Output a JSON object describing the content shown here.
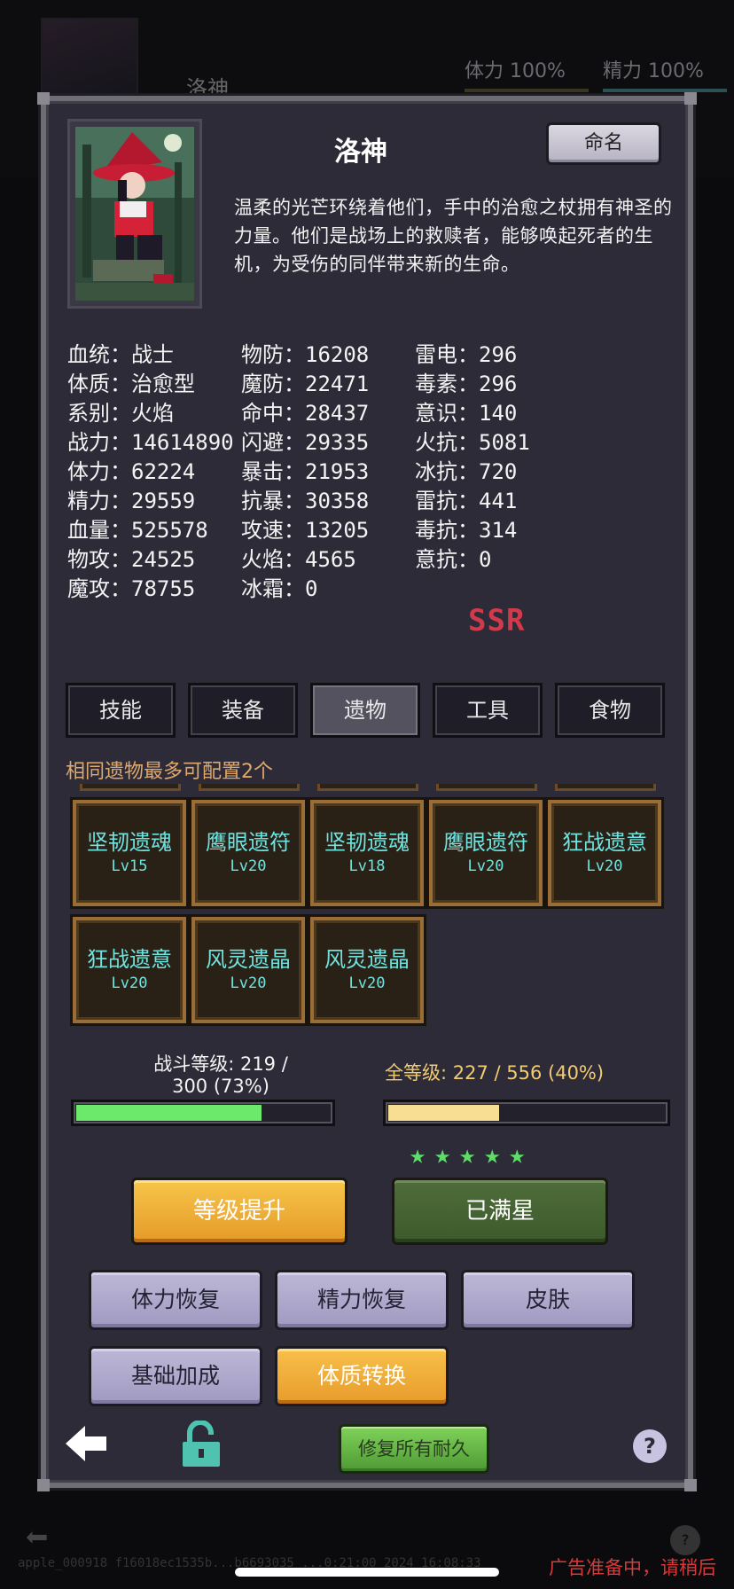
{
  "background": {
    "name": "洛神",
    "stamina_label": "体力 100%",
    "energy_label": "精力 100%",
    "ad_text": "广告准备中，请稍后",
    "footer_text": "apple_000918 f16018ec1535b...b6693035 ...0:21:00 2024 16:08:33"
  },
  "hero": {
    "name": "洛神",
    "rename_label": "命名",
    "description": "温柔的光芒环绕着他们，手中的治愈之杖拥有神圣的力量。他们是战场上的救赎者，能够唤起死者的生机，为受伤的同伴带来新的生命。"
  },
  "stats": {
    "col1": [
      {
        "key": "血统：",
        "value": "战士"
      },
      {
        "key": "体质：",
        "value": "治愈型"
      },
      {
        "key": "系别：",
        "value": "火焰"
      },
      {
        "key": "战力：",
        "value": "14614890"
      },
      {
        "key": "体力：",
        "value": "62224"
      },
      {
        "key": "精力：",
        "value": "29559"
      },
      {
        "key": "血量：",
        "value": "525578"
      },
      {
        "key": "物攻：",
        "value": "24525"
      },
      {
        "key": "魔攻：",
        "value": "78755"
      }
    ],
    "col2": [
      {
        "key": "物防：",
        "value": "16208"
      },
      {
        "key": "魔防：",
        "value": "22471"
      },
      {
        "key": "命中：",
        "value": "28437"
      },
      {
        "key": "闪避：",
        "value": "29335"
      },
      {
        "key": "暴击：",
        "value": "21953"
      },
      {
        "key": "抗暴：",
        "value": "30358"
      },
      {
        "key": "攻速：",
        "value": "13205"
      },
      {
        "key": "火焰：",
        "value": "4565"
      },
      {
        "key": "冰霜：",
        "value": "0"
      }
    ],
    "col3": [
      {
        "key": "雷电：",
        "value": "296"
      },
      {
        "key": "毒素：",
        "value": "296"
      },
      {
        "key": "意识：",
        "value": "140"
      },
      {
        "key": "火抗：",
        "value": "5081"
      },
      {
        "key": "冰抗：",
        "value": "720"
      },
      {
        "key": "雷抗：",
        "value": "441"
      },
      {
        "key": "毒抗：",
        "value": "314"
      },
      {
        "key": "意抗：",
        "value": "0"
      }
    ],
    "rarity": "SSR",
    "rarity_color": "#d2394a"
  },
  "tabs": [
    {
      "label": "技能",
      "active": false
    },
    {
      "label": "装备",
      "active": false
    },
    {
      "label": "遗物",
      "active": true
    },
    {
      "label": "工具",
      "active": false
    },
    {
      "label": "食物",
      "active": false
    }
  ],
  "relics": {
    "hint": "相同遗物最多可配置2个",
    "items": [
      {
        "name": "坚韧遗魂",
        "level": "Lv15"
      },
      {
        "name": "鹰眼遗符",
        "level": "Lv20"
      },
      {
        "name": "坚韧遗魂",
        "level": "Lv18"
      },
      {
        "name": "鹰眼遗符",
        "level": "Lv20"
      },
      {
        "name": "狂战遗意",
        "level": "Lv20"
      },
      {
        "name": "狂战遗意",
        "level": "Lv20"
      },
      {
        "name": "风灵遗晶",
        "level": "Lv20"
      },
      {
        "name": "风灵遗晶",
        "level": "Lv20"
      }
    ]
  },
  "levels": {
    "battle_label_line1": "战斗等级: 219 /",
    "battle_label_line2": "300 (73%)",
    "battle_progress": 0.73,
    "total_label": "全等级: 227 / 556 (40%)",
    "total_progress": 0.4,
    "stars": 5,
    "star_color": "#5fdc6a"
  },
  "buttons": {
    "upgrade": "等级提升",
    "full_star": "已满星",
    "stamina_restore": "体力恢复",
    "energy_restore": "精力恢复",
    "skin": "皮肤",
    "base_bonus": "基础加成",
    "constitution_change": "体质转换",
    "repair_all": "修复所有耐久",
    "help": "?"
  },
  "icons": {
    "back": "back-arrow-icon",
    "lock": "unlock-icon",
    "star": "star-icon"
  }
}
